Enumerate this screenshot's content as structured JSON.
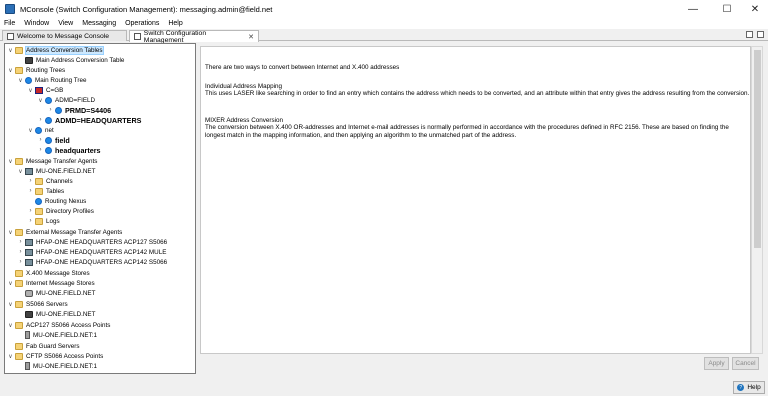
{
  "window": {
    "title": "MConsole (Switch Configuration Management): messaging.admin@field.net",
    "controls": {
      "minimize": "—",
      "maximize": "☐",
      "close": "✕"
    }
  },
  "menu": [
    "File",
    "Window",
    "View",
    "Messaging",
    "Operations",
    "Help"
  ],
  "tabs": [
    {
      "label": "Welcome to Message Console",
      "active": false
    },
    {
      "label": "Switch Configuration Management",
      "active": true
    }
  ],
  "tab_close": "✕",
  "tree": [
    {
      "label": "Address Conversion Tables",
      "icon": "folder-icon",
      "toggle": "∨",
      "selected": true
    },
    {
      "label": "Main Address Conversion Table",
      "icon": "table-icon",
      "toggle": ""
    },
    {
      "label": "Routing Trees",
      "icon": "folder-icon",
      "toggle": "∨"
    },
    {
      "label": "Main Routing Tree",
      "icon": "globe-icon",
      "toggle": "∨"
    },
    {
      "label": "C=GB",
      "icon": "flag-icon",
      "toggle": "∨"
    },
    {
      "label": "ADMD=FIELD",
      "icon": "globe-icon",
      "toggle": "∨"
    },
    {
      "label": "PRMD=S4406",
      "icon": "globe-icon",
      "toggle": "›",
      "bold": true
    },
    {
      "label": "ADMD=HEADQUARTERS",
      "icon": "globe-icon",
      "toggle": "›",
      "bold": true
    },
    {
      "label": "net",
      "icon": "globe-icon",
      "toggle": "∨"
    },
    {
      "label": "field",
      "icon": "globe-icon",
      "toggle": "›",
      "bold": true
    },
    {
      "label": "headquarters",
      "icon": "globe-icon",
      "toggle": "›",
      "bold": true
    },
    {
      "label": "Message Transfer Agents",
      "icon": "folder-icon",
      "toggle": "∨"
    },
    {
      "label": "MU-ONE.FIELD.NET",
      "icon": "mta-icon",
      "toggle": "∨"
    },
    {
      "label": "Channels",
      "icon": "folder-icon",
      "toggle": "›"
    },
    {
      "label": "Tables",
      "icon": "folder-icon",
      "toggle": "›"
    },
    {
      "label": "Routing Nexus",
      "icon": "globe-icon",
      "toggle": ""
    },
    {
      "label": "Directory Profiles",
      "icon": "folder-icon",
      "toggle": "›"
    },
    {
      "label": "Logs",
      "icon": "folder-icon",
      "toggle": "›"
    },
    {
      "label": "External Message Transfer Agents",
      "icon": "folder-icon",
      "toggle": "∨"
    },
    {
      "label": "HFAP-ONE HEADQUARTERS ACP127 S5066",
      "icon": "mta-icon",
      "toggle": "›"
    },
    {
      "label": "HFAP-ONE HEADQUARTERS ACP142 MULE",
      "icon": "mta-icon",
      "toggle": "›"
    },
    {
      "label": "HFAP-ONE HEADQUARTERS ACP142 S5066",
      "icon": "mta-icon",
      "toggle": "›"
    },
    {
      "label": "X.400 Message Stores",
      "icon": "folder-icon",
      "toggle": ""
    },
    {
      "label": "Internet Message Stores",
      "icon": "folder-icon",
      "toggle": "∨"
    },
    {
      "label": "MU-ONE.FIELD.NET",
      "icon": "database-icon",
      "toggle": ""
    },
    {
      "label": "S5066 Servers",
      "icon": "folder-icon",
      "toggle": "∨"
    },
    {
      "label": "MU-ONE.FIELD.NET",
      "icon": "server-icon",
      "toggle": ""
    },
    {
      "label": "ACP127 S5066 Access Points",
      "icon": "folder-icon",
      "toggle": "∨"
    },
    {
      "label": "MU-ONE.FIELD.NET:1",
      "icon": "access-point-icon",
      "toggle": ""
    },
    {
      "label": "Fab Guard Servers",
      "icon": "folder-icon",
      "toggle": ""
    },
    {
      "label": "CFTP S5066 Access Points",
      "icon": "folder-icon",
      "toggle": "∨"
    },
    {
      "label": "MU-ONE.FIELD.NET:1",
      "icon": "access-point-icon",
      "toggle": ""
    }
  ],
  "content": {
    "intro": "There are two ways to convert between Internet and X.400 addresses",
    "section1_title": "Individual Address Mapping",
    "section1_body": "This uses LASER like searching in order to find an entry which contains the address which needs to be converted, and an attribute within that entry gives the address resulting from the conversion.",
    "section2_title": "MIXER Address Conversion",
    "section2_body": "The conversion between X.400 OR-addresses and Internet e-mail addresses is normally performed in accordance with the procedures defined in RFC 2156. These are based on finding the longest match in the mapping information, and then applying an algorithm to the unmatched part of the address."
  },
  "buttons": {
    "apply": "Apply",
    "cancel": "Cancel",
    "help": "Help",
    "help_icon": "?"
  }
}
